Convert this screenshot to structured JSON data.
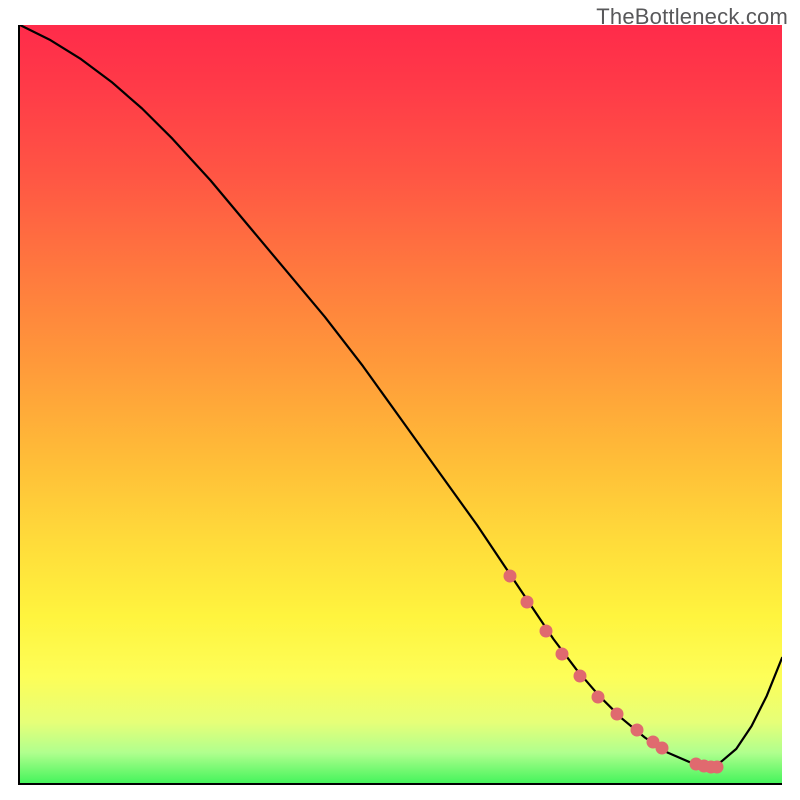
{
  "watermark": "TheBottleneck.com",
  "chart_data": {
    "type": "line",
    "title": "",
    "xlabel": "",
    "ylabel": "",
    "xlim": [
      0,
      100
    ],
    "ylim": [
      0,
      100
    ],
    "grid": false,
    "series": [
      {
        "name": "curve",
        "x": [
          0,
          4,
          8,
          12,
          16,
          20,
          25,
          30,
          35,
          40,
          45,
          50,
          55,
          60,
          64,
          67,
          70,
          73,
          76,
          79,
          82,
          85,
          88,
          90,
          92,
          94,
          96,
          98,
          100
        ],
        "y": [
          100,
          98,
          95.5,
          92.5,
          89,
          85,
          79.5,
          73.5,
          67.5,
          61.5,
          55,
          48,
          41,
          34,
          28,
          23.5,
          19,
          15,
          11.5,
          8.5,
          6,
          4,
          2.7,
          2.3,
          2.8,
          4.5,
          7.5,
          11.5,
          16.5
        ]
      }
    ],
    "markers": {
      "name": "highlight-dots",
      "x": [
        64.2,
        66.3,
        68.8,
        71.0,
        73.3,
        75.7,
        78.2,
        80.8,
        82.8,
        84.0,
        88.5,
        89.5,
        90.5,
        91.2
      ],
      "y": [
        27.5,
        24.1,
        20.3,
        17.2,
        14.3,
        11.6,
        9.3,
        7.2,
        5.7,
        4.9,
        2.8,
        2.5,
        2.4,
        2.4
      ]
    },
    "background_gradient": {
      "direction": "vertical",
      "stops": [
        {
          "pos": 0.0,
          "color": "#ff2b4a"
        },
        {
          "pos": 0.2,
          "color": "#ff5644"
        },
        {
          "pos": 0.45,
          "color": "#ff9a3a"
        },
        {
          "pos": 0.68,
          "color": "#ffdb3a"
        },
        {
          "pos": 0.86,
          "color": "#fdfe58"
        },
        {
          "pos": 1.0,
          "color": "#46f45c"
        }
      ]
    }
  }
}
